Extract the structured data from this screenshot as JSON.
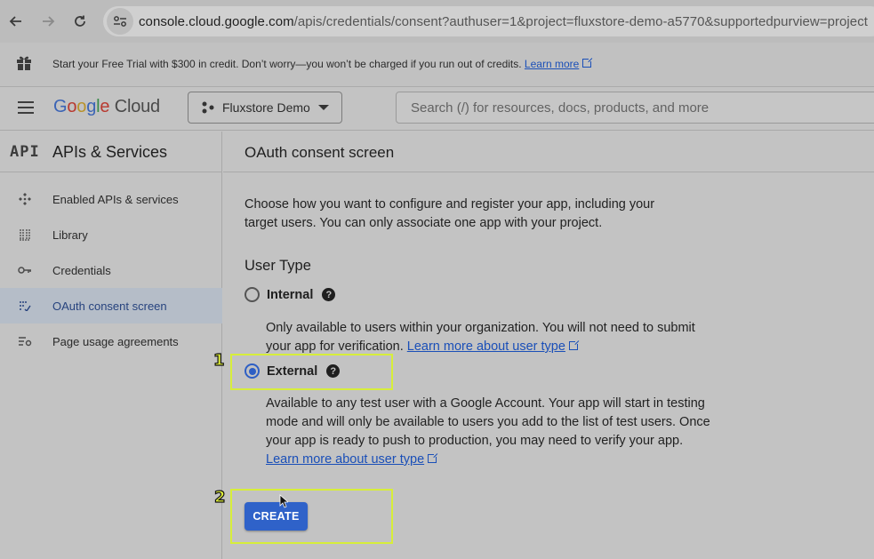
{
  "browser": {
    "url_host": "console.cloud.google.com",
    "url_path": "/apis/credentials/consent?authuser=1&project=fluxstore-demo-a5770&supportedpurview=project"
  },
  "banner": {
    "text": "Start your Free Trial with $300 in credit. Don’t worry—you won’t be charged if you run out of credits.",
    "link": "Learn more"
  },
  "header": {
    "logo": [
      "G",
      "o",
      "o",
      "g",
      "l",
      "e"
    ],
    "logo_suffix": "Cloud",
    "project": "Fluxstore Demo",
    "search_placeholder": "Search (/) for resources, docs, products, and more"
  },
  "sidebar": {
    "badge": "API",
    "title": "APIs & Services",
    "items": [
      {
        "label": "Enabled APIs & services",
        "icon": "enabled-apis-icon"
      },
      {
        "label": "Library",
        "icon": "library-icon"
      },
      {
        "label": "Credentials",
        "icon": "key-icon"
      },
      {
        "label": "OAuth consent screen",
        "icon": "consent-icon",
        "active": true
      },
      {
        "label": "Page usage agreements",
        "icon": "settings-list-icon"
      }
    ]
  },
  "main": {
    "title": "OAuth consent screen",
    "intro": "Choose how you want to configure and register your app, including your target users. You can only associate one app with your project.",
    "section": "User Type",
    "internal": {
      "label": "Internal",
      "desc": "Only available to users within your organization. You will not need to submit your app for verification.",
      "link": "Learn more about user type"
    },
    "external": {
      "label": "External",
      "desc": "Available to any test user with a Google Account. Your app will start in testing mode and will only be available to users you add to the list of test users. Once your app is ready to push to production, you may need to verify your app.",
      "link": "Learn more about user type"
    },
    "create": "CREATE"
  },
  "annotations": {
    "step1": "1",
    "step2": "2",
    "color": "#d7ee3a"
  }
}
